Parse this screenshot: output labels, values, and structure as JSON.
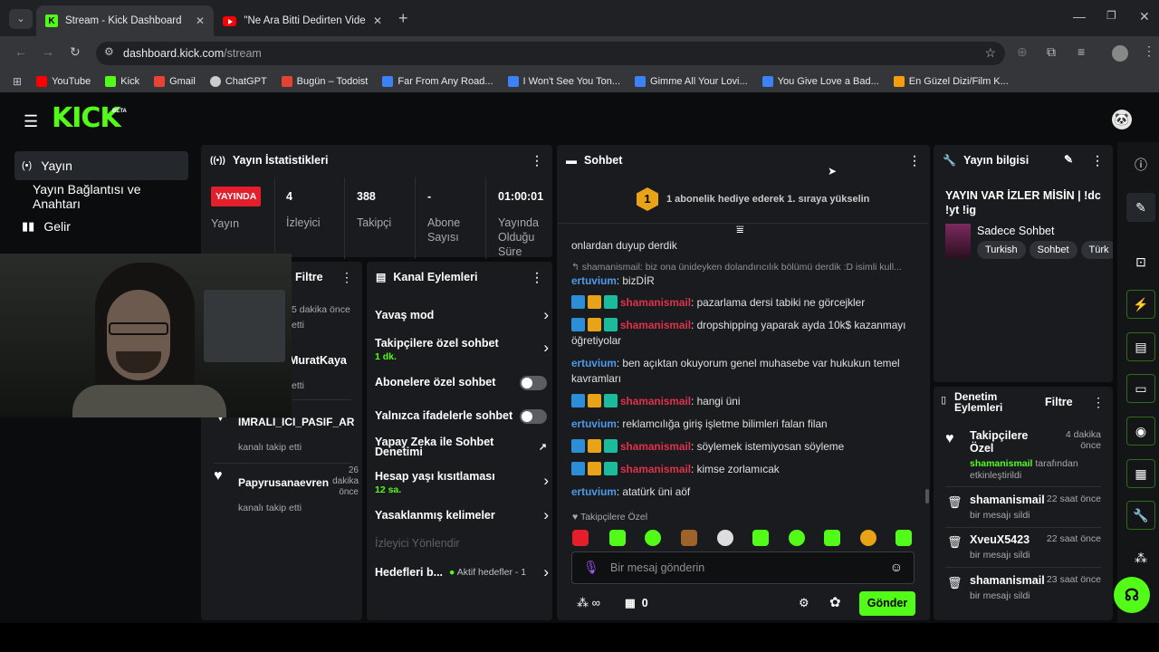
{
  "browser": {
    "tabs": [
      {
        "title": "Stream - Kick Dashboard"
      },
      {
        "title": "\"Ne Ara Bitti Dedirten Video\" K"
      }
    ],
    "url_host": "dashboard.kick.com",
    "url_path": "/stream",
    "bookmarks": [
      {
        "label": "YouTube",
        "color": "#ff0000"
      },
      {
        "label": "Kick",
        "color": "#53fc18"
      },
      {
        "label": "Gmail",
        "color": "#ea4335"
      },
      {
        "label": "ChatGPT",
        "color": "#cccccc"
      },
      {
        "label": "Bugün – Todoist",
        "color": "#e44332"
      },
      {
        "label": "Far From Any Road...",
        "color": "#3b82f6"
      },
      {
        "label": "I Won't See You Ton...",
        "color": "#3b82f6"
      },
      {
        "label": "Gimme All Your Lovi...",
        "color": "#3b82f6"
      },
      {
        "label": "You Give Love a Bad...",
        "color": "#3b82f6"
      },
      {
        "label": "En Güzel Dizi/Film K...",
        "color": "#f59e0b"
      }
    ]
  },
  "kick": {
    "logo": "KICK",
    "logo_badge": "BETA",
    "accent": "#53fc18",
    "sidebar": {
      "items": [
        {
          "label": "Yayın"
        },
        {
          "label": "Yayın Bağlantısı ve Anahtarı"
        },
        {
          "label": "Gelir"
        }
      ]
    },
    "stats": {
      "title": "Yayın İstatistikleri",
      "live_badge": "YAYINDA",
      "live_label": "Yayın",
      "viewers": "4",
      "viewers_label": "İzleyici",
      "followers": "388",
      "followers_label": "Takipçi",
      "subs": "-",
      "subs_label": "Abone Sayısı",
      "uptime": "01:00:01",
      "uptime_label": "Yayında Olduğu Süre"
    },
    "activity": {
      "filter_label": "Filtre",
      "items": [
        {
          "time": "5 dakika önce",
          "desc": "etti"
        },
        {
          "name": "sMuratKaya",
          "desc": "etti"
        },
        {
          "name": "IMRALI_ICI_PASIF_ARA",
          "desc": "kanalı takip etti"
        },
        {
          "name": "Papyrusanaevren",
          "time": "26 dakika önce",
          "desc": "kanalı takip etti"
        }
      ]
    },
    "channel_actions": {
      "title": "Kanal Eylemleri",
      "slow_mode": "Yavaş mod",
      "followers_only": "Takipçilere özel sohbet",
      "followers_only_value": "1 dk.",
      "subs_only": "Abonelere özel sohbet",
      "emotes_only": "Yalnızca ifadelerle sohbet",
      "ai_moderation": "Yapay Zeka ile Sohbet Denetimi",
      "account_age": "Hesap yaşı kısıtlaması",
      "account_age_value": "12 sa.",
      "banned_words": "Yasaklanmış kelimeler",
      "raid": "İzleyici Yönlendir",
      "goals": "Hedefleri b...",
      "goals_status": "Aktif hedefler - 1"
    },
    "chat": {
      "title": "Sohbet",
      "gift_rank": "1",
      "gift_text": "1 abonelik hediye ederek 1. sıraya yükselin",
      "partial_line": "onlardan duyup derdik",
      "reply_line": "shamanismail: biz ona ünideyken dolandırıcılık bölümü derdik :D isimli kull...",
      "messages": [
        {
          "user": "ertuvium",
          "text": "bizDİR"
        },
        {
          "user": "shamanismail",
          "text": "pazarlama dersi tabiki ne görcejkler"
        },
        {
          "user": "shamanismail",
          "text": "dropshipping yaparak ayda 10k$ kazanmayı öğretiyolar"
        },
        {
          "user": "ertuvium",
          "text": "ben açıktan okuyorum genel muhasebe var hukukun temel kavramları"
        },
        {
          "user": "shamanismail",
          "text": "hangi üni"
        },
        {
          "user": "ertuvium",
          "text": "reklamcılığa giriş işletme bilimleri falan filan"
        },
        {
          "user": "shamanismail",
          "text": "söylemek istemiyosan söyleme"
        },
        {
          "user": "shamanismail",
          "text": "kimse zorlamıcak"
        },
        {
          "user": "ertuvium",
          "text": "atatürk üni aöf"
        }
      ],
      "mode_label": "Takipçilere Özel",
      "input_placeholder": "Bir mesaj gönderin",
      "kicks": "∞",
      "stash": "0",
      "send_label": "Gönder"
    },
    "stream_info": {
      "title": "Yayın bilgisi",
      "stream_title": "YAYIN VAR İZLER MİSİN | !dc !yt !ig",
      "category": "Sadece Sohbet",
      "tags": [
        "Turkish",
        "Sohbet",
        "Türk"
      ]
    },
    "mod_actions": {
      "title": "Denetim Eylemleri",
      "filter_label": "Filtre",
      "items": [
        {
          "name": "Takipçilere Özel",
          "time": "4 dakika önce",
          "by": "shamanismail",
          "desc": "tarafından etkinleştirildi"
        },
        {
          "name": "shamanismail",
          "time": "22 saat önce",
          "desc": "bir mesajı sildi"
        },
        {
          "name": "XveuX5423",
          "time": "22 saat önce",
          "desc": "bir mesajı sildi"
        },
        {
          "name": "shamanismail",
          "time": "23 saat önce",
          "desc": "bir mesajı sildi"
        }
      ]
    }
  }
}
